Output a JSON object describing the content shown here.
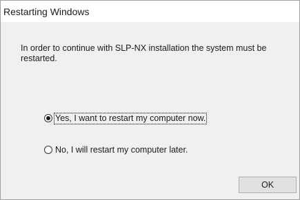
{
  "window": {
    "title": "Restarting Windows"
  },
  "message": "In order to continue with SLP-NX installation the system must be restarted.",
  "options": [
    {
      "label": "Yes, I want to restart my computer now.",
      "selected": true,
      "focused": true
    },
    {
      "label": "No, I will restart my computer later.",
      "selected": false,
      "focused": false
    }
  ],
  "buttons": {
    "ok_label": "OK"
  },
  "colors": {
    "title_bar_bg": "#ffffff",
    "dialog_bg": "#f0f0f0",
    "button_bg": "#e1e1e1",
    "button_border": "#adadad",
    "border": "#a0a0a0"
  }
}
